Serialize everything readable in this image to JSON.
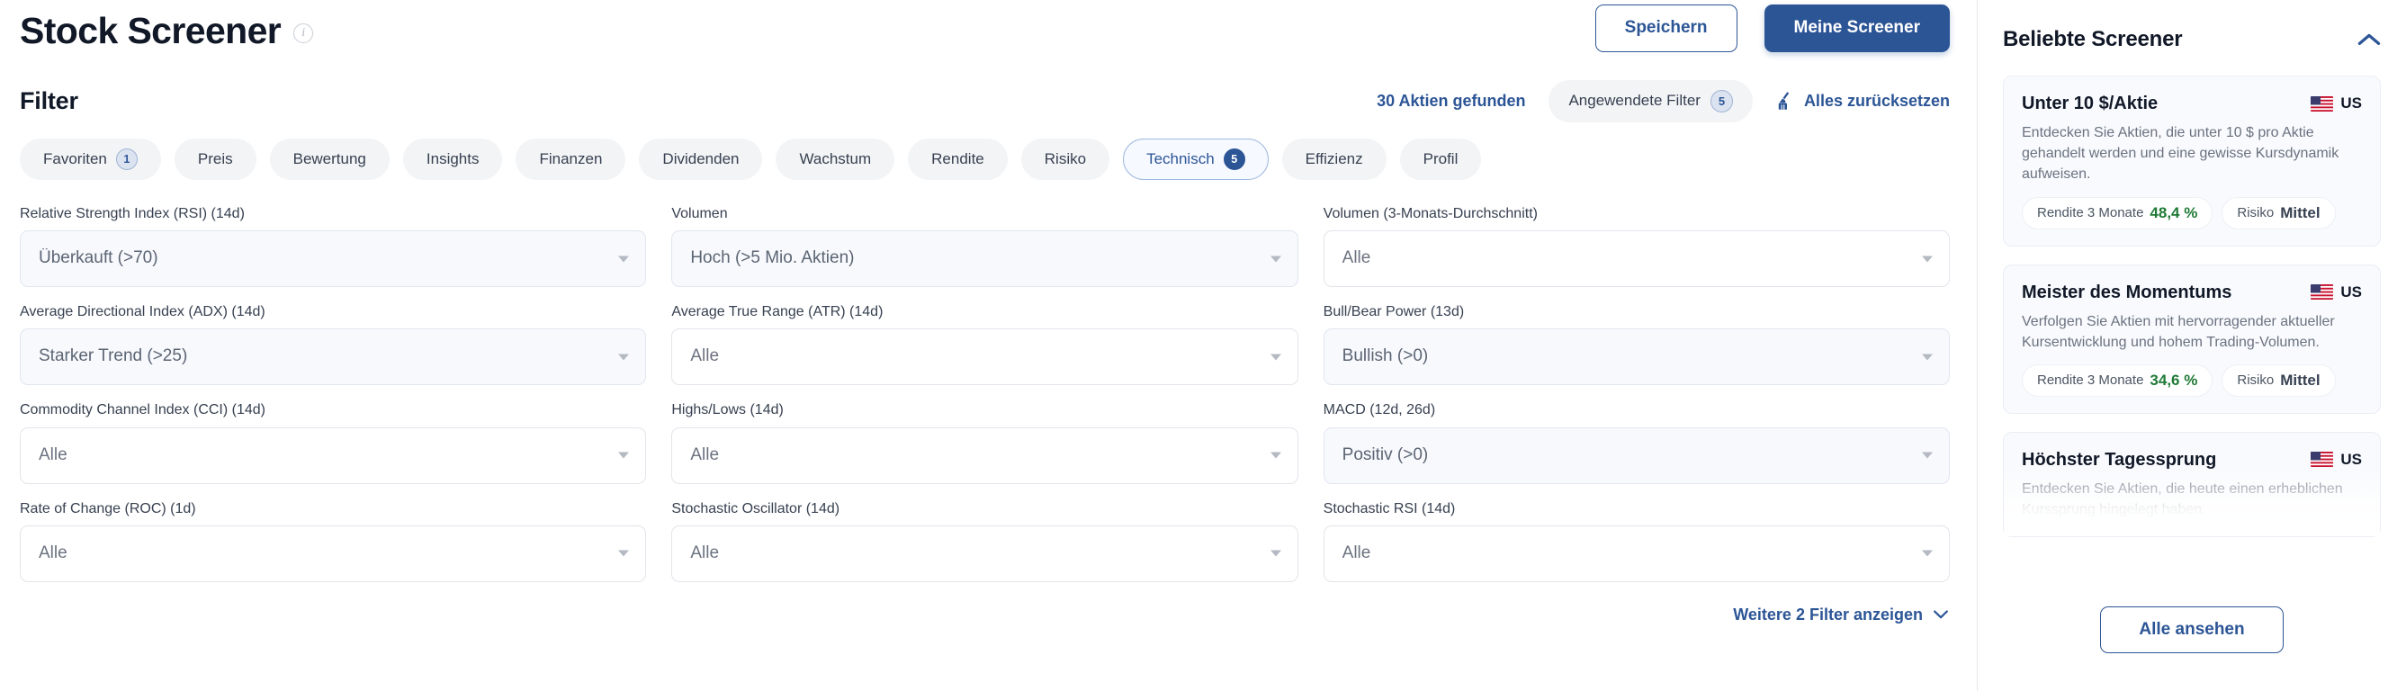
{
  "header": {
    "title": "Stock Screener",
    "info_icon": "info-icon",
    "save_label": "Speichern",
    "my_screener_label": "Meine Screener"
  },
  "filter_bar": {
    "heading": "Filter",
    "found_count": "30 Aktien gefunden",
    "applied_label": "Angewendete Filter",
    "applied_count": "5",
    "reset_label": "Alles zurücksetzen",
    "reset_icon": "broom-icon"
  },
  "tabs": [
    {
      "label": "Favoriten",
      "badge": "1",
      "active": false
    },
    {
      "label": "Preis",
      "badge": "",
      "active": false
    },
    {
      "label": "Bewertung",
      "badge": "",
      "active": false
    },
    {
      "label": "Insights",
      "badge": "",
      "active": false
    },
    {
      "label": "Finanzen",
      "badge": "",
      "active": false
    },
    {
      "label": "Dividenden",
      "badge": "",
      "active": false
    },
    {
      "label": "Wachstum",
      "badge": "",
      "active": false
    },
    {
      "label": "Rendite",
      "badge": "",
      "active": false
    },
    {
      "label": "Risiko",
      "badge": "",
      "active": false
    },
    {
      "label": "Technisch",
      "badge": "5",
      "active": true
    },
    {
      "label": "Effizienz",
      "badge": "",
      "active": false
    },
    {
      "label": "Profil",
      "badge": "",
      "active": false
    }
  ],
  "filters": [
    {
      "label": "Relative Strength Index (RSI) (14d)",
      "value": "Überkauft (>70)",
      "filled": true
    },
    {
      "label": "Volumen",
      "value": "Hoch (>5 Mio. Aktien)",
      "filled": true
    },
    {
      "label": "Volumen (3-Monats-Durchschnitt)",
      "value": "Alle",
      "filled": false
    },
    {
      "label": "Average Directional Index (ADX) (14d)",
      "value": "Starker Trend (>25)",
      "filled": true
    },
    {
      "label": "Average True Range (ATR) (14d)",
      "value": "Alle",
      "filled": false
    },
    {
      "label": "Bull/Bear Power (13d)",
      "value": "Bullish (>0)",
      "filled": true
    },
    {
      "label": "Commodity Channel Index (CCI) (14d)",
      "value": "Alle",
      "filled": false
    },
    {
      "label": "Highs/Lows (14d)",
      "value": "Alle",
      "filled": false
    },
    {
      "label": "MACD (12d, 26d)",
      "value": "Positiv (>0)",
      "filled": true
    },
    {
      "label": "Rate of Change (ROC) (1d)",
      "value": "Alle",
      "filled": false
    },
    {
      "label": "Stochastic Oscillator (14d)",
      "value": "Alle",
      "filled": false
    },
    {
      "label": "Stochastic RSI (14d)",
      "value": "Alle",
      "filled": false
    }
  ],
  "more_filters": {
    "label": "Weitere 2 Filter anzeigen",
    "icon": "chevron-down-icon"
  },
  "sidebar": {
    "title": "Beliebte Screener",
    "collapse_icon": "chevron-up-icon",
    "view_all_label": "Alle ansehen",
    "cards": [
      {
        "title": "Unter 10 $/Aktie",
        "region": "US",
        "flag_icon": "us-flag-icon",
        "description": "Entdecken Sie Aktien, die unter 10 $ pro Aktie gehandelt werden und eine gewisse Kursdynamik aufweisen.",
        "pills": [
          {
            "label": "Rendite 3 Monate",
            "value": "48,4 %",
            "positive": true
          },
          {
            "label": "Risiko",
            "value": "Mittel",
            "positive": false
          }
        ]
      },
      {
        "title": "Meister des Momentums",
        "region": "US",
        "flag_icon": "us-flag-icon",
        "description": "Verfolgen Sie Aktien mit hervorragender aktueller Kursentwicklung und hohem Trading-Volumen.",
        "pills": [
          {
            "label": "Rendite 3 Monate",
            "value": "34,6 %",
            "positive": true
          },
          {
            "label": "Risiko",
            "value": "Mittel",
            "positive": false
          }
        ]
      },
      {
        "title": "Höchster Tagessprung",
        "region": "US",
        "flag_icon": "us-flag-icon",
        "description": "Entdecken Sie Aktien, die heute einen erheblichen Kurssprung hingelegt haben.",
        "pills": []
      }
    ]
  },
  "colors": {
    "brand": "#2c5596",
    "positive": "#1f7a36",
    "chip_bg": "#f3f4f6",
    "filled_field": "#f7f9fd"
  }
}
